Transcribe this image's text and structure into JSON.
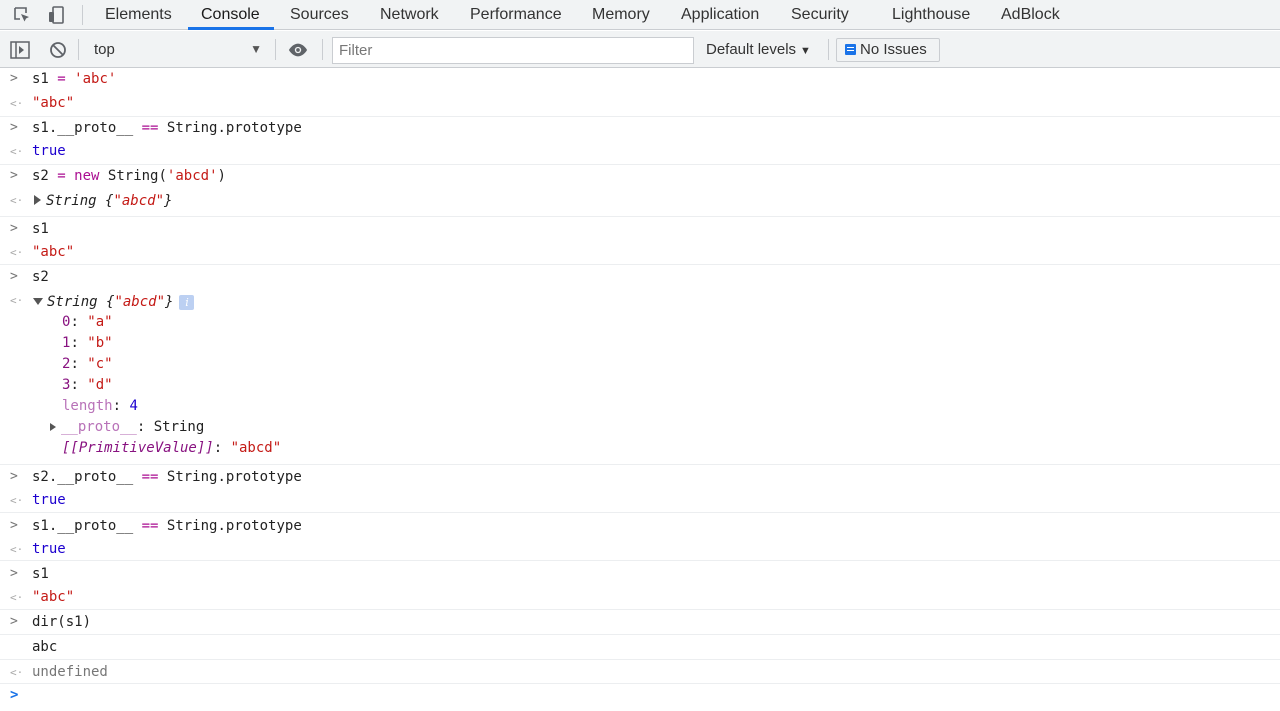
{
  "tabs": [
    {
      "label": "Elements"
    },
    {
      "label": "Console"
    },
    {
      "label": "Sources"
    },
    {
      "label": "Network"
    },
    {
      "label": "Performance"
    },
    {
      "label": "Memory"
    },
    {
      "label": "Application"
    },
    {
      "label": "Security"
    },
    {
      "label": "Lighthouse"
    },
    {
      "label": "AdBlock"
    }
  ],
  "active_tab": "Console",
  "toolbar": {
    "context": "top",
    "filter_placeholder": "Filter",
    "filter_value": "",
    "levels": "Default levels",
    "issues": "No Issues"
  },
  "console": {
    "l1": {
      "var": "s1",
      "op": "=",
      "val": "'abc'"
    },
    "r1": "\"abc\"",
    "l2": {
      "expr": "s1.__proto__",
      "op": "==",
      "rhs": "String.prototype"
    },
    "r2": "true",
    "l3": {
      "var": "s2",
      "op": "=",
      "kw": "new",
      "call": "String(",
      "arg": "'abcd'",
      "close": ")"
    },
    "r3": {
      "name": "String",
      "open": "{",
      "val": "\"abcd\"",
      "close": "}"
    },
    "l4": "s1",
    "r4": "\"abc\"",
    "l5": "s2",
    "r5": {
      "name": "String",
      "open": "{",
      "val": "\"abcd\"",
      "close": "}",
      "info": "i",
      "props": [
        {
          "key": "0",
          "value": "\"a\""
        },
        {
          "key": "1",
          "value": "\"b\""
        },
        {
          "key": "2",
          "value": "\"c\""
        },
        {
          "key": "3",
          "value": "\"d\""
        }
      ],
      "length_key": "length",
      "length_value": "4",
      "proto_key": "__proto__",
      "proto_value": "String",
      "prim_key": "[[PrimitiveValue]]",
      "prim_value": "\"abcd\""
    },
    "l6": {
      "expr": "s2.__proto__",
      "op": "==",
      "rhs": "String.prototype"
    },
    "r6": "true",
    "l7": {
      "expr": "s1.__proto__",
      "op": "==",
      "rhs": "String.prototype"
    },
    "r7": "true",
    "l8": "s1",
    "r8": "\"abc\"",
    "l9": "dir(s1)",
    "o9": "abc",
    "r9": "undefined"
  }
}
